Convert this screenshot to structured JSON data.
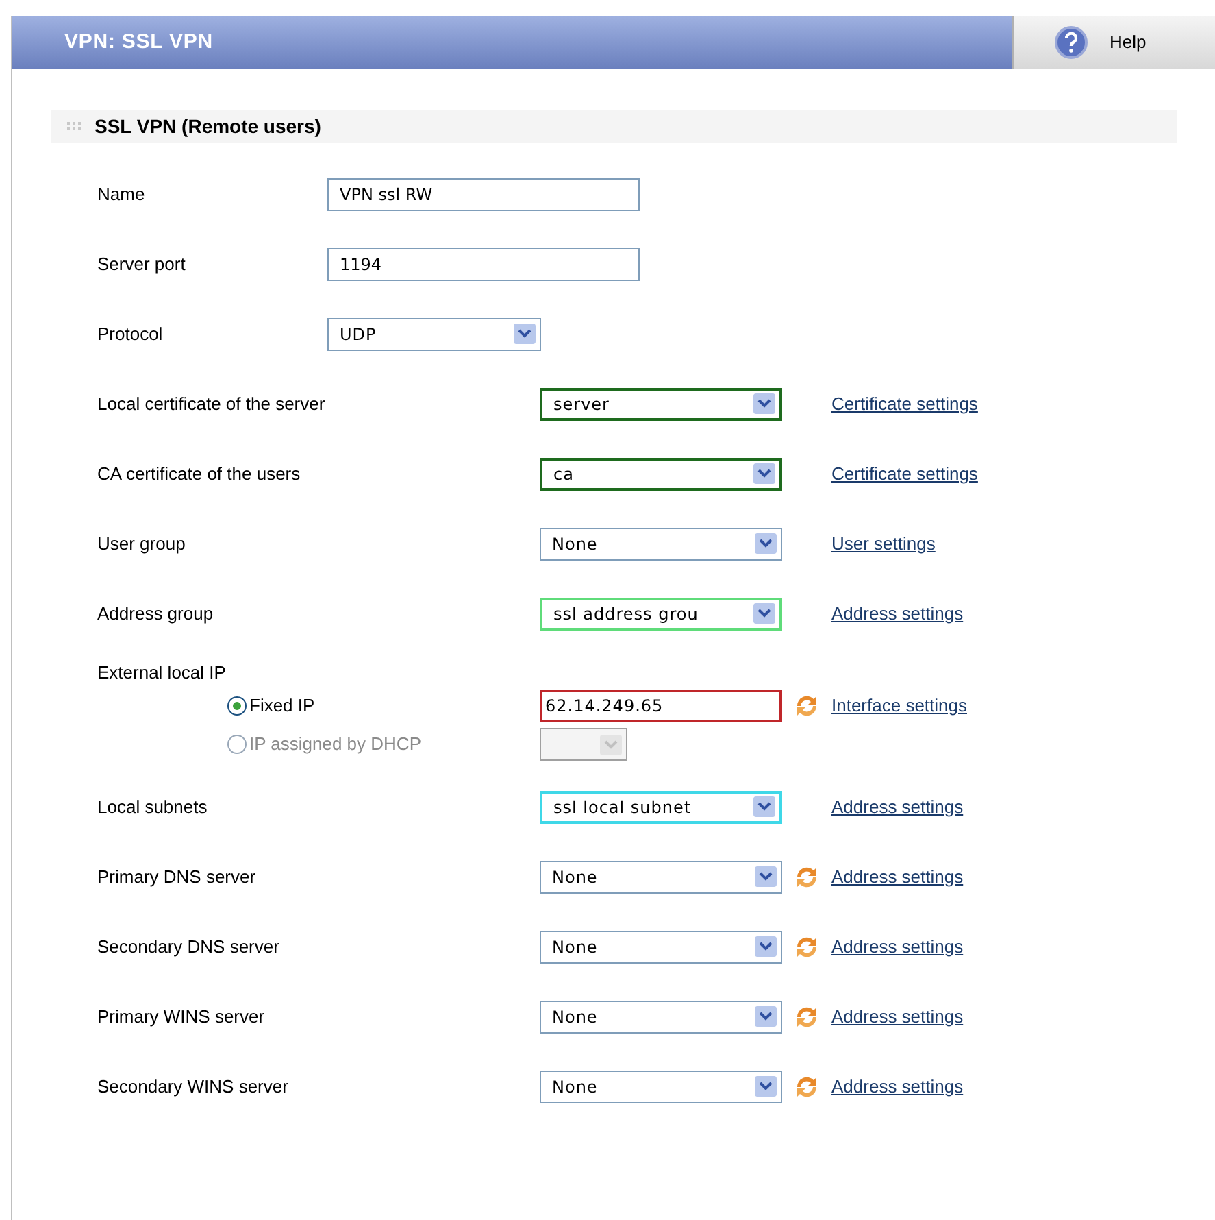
{
  "header": {
    "title": "VPN: SSL VPN",
    "help_label": "Help"
  },
  "section": {
    "title": "SSL VPN (Remote users)"
  },
  "rows": [
    {
      "kind": "input",
      "label": "Name",
      "value": "VPN ssl RW"
    },
    {
      "kind": "input",
      "label": "Server port",
      "value": "1194"
    },
    {
      "kind": "short_select",
      "label": "Protocol",
      "value": "UDP"
    },
    {
      "kind": "select",
      "label": "Local certificate of the server",
      "value": "server",
      "color": "#1e6b1e",
      "refresh": false,
      "link": "Certificate settings"
    },
    {
      "kind": "select",
      "label": "CA certificate of the users",
      "value": "ca",
      "color": "#1e6b1e",
      "refresh": false,
      "link": "Certificate settings"
    },
    {
      "kind": "select",
      "label": "User group",
      "value": "None",
      "refresh": false,
      "link": "User settings"
    },
    {
      "kind": "select",
      "label": "Address group",
      "value": "ssl address grou",
      "color": "#5fdc7a",
      "refresh": false,
      "link": "Address settings"
    },
    {
      "kind": "ip_choice",
      "label": "External local IP",
      "options": [
        {
          "label": "Fixed IP",
          "selected": true,
          "kind": "input",
          "value": "62.14.249.65",
          "color": "#c0262a",
          "refresh": true,
          "link": "Interface settings"
        },
        {
          "label": "IP assigned by DHCP",
          "selected": false,
          "disabled": true,
          "kind": "select"
        }
      ]
    },
    {
      "kind": "select",
      "label": "Local subnets",
      "value": "ssl local subnet",
      "color": "#3fd8e8",
      "refresh": false,
      "link": "Address settings"
    },
    {
      "kind": "select",
      "label": "Primary DNS server",
      "value": "None",
      "refresh": true,
      "link": "Address settings"
    },
    {
      "kind": "select",
      "label": "Secondary DNS server",
      "value": "None",
      "refresh": true,
      "link": "Address settings"
    },
    {
      "kind": "select",
      "label": "Primary WINS server",
      "value": "None",
      "refresh": true,
      "link": "Address settings"
    },
    {
      "kind": "select",
      "label": "Secondary WINS server",
      "value": "None",
      "refresh": true,
      "link": "Address settings"
    }
  ]
}
